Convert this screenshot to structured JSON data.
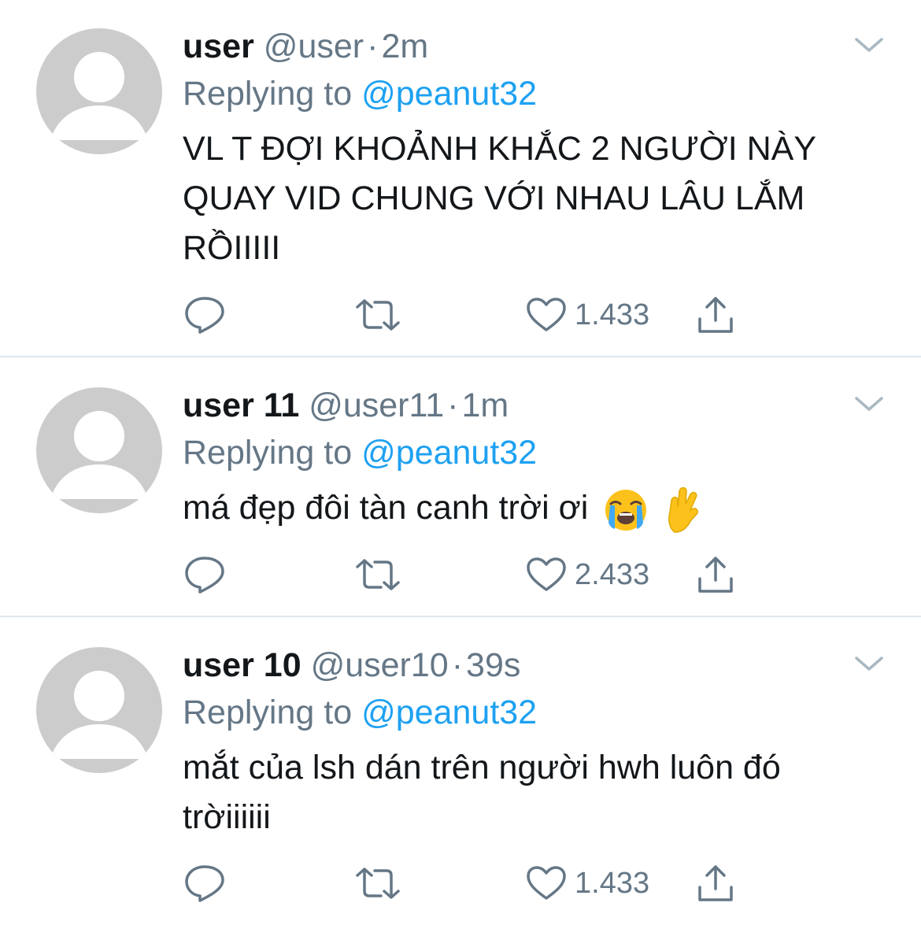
{
  "tweets": [
    {
      "name": "user",
      "handle": "@user",
      "separator": "·",
      "time": "2m",
      "reply_prefix": "Replying to",
      "reply_to": "@peanut32",
      "text": "VL T ĐỢI KHOẢNH KHẮC 2 NGƯỜI NÀY QUAY VID CHUNG VỚI NHAU LÂU LẮM RỒIIIII",
      "likes": "1.433",
      "emojis": []
    },
    {
      "name": "user 11",
      "handle": "@user11",
      "separator": "·",
      "time": "1m",
      "reply_prefix": "Replying to",
      "reply_to": "@peanut32",
      "text": "má đẹp đôi tàn canh trời ơi",
      "likes": "2.433",
      "emojis": [
        "loudly-crying-face",
        "crossed-fingers"
      ]
    },
    {
      "name": "user 10",
      "handle": "@user10",
      "separator": "·",
      "time": "39s",
      "reply_prefix": "Replying to",
      "reply_to": "@peanut32",
      "text": "mắt của lsh dán trên người hwh luôn đó trờiiiiii",
      "likes": "1.433",
      "emojis": []
    }
  ],
  "icons": {
    "reply": "reply-icon",
    "retweet": "retweet-icon",
    "like": "heart-icon",
    "share": "share-icon",
    "menu": "chevron-down-icon",
    "avatar": "default-avatar-icon"
  },
  "colors": {
    "text": "#14171a",
    "secondary": "#657786",
    "mention": "#1da1f2",
    "divider": "#e1e8ed",
    "avatar_bg": "#cccccc"
  }
}
